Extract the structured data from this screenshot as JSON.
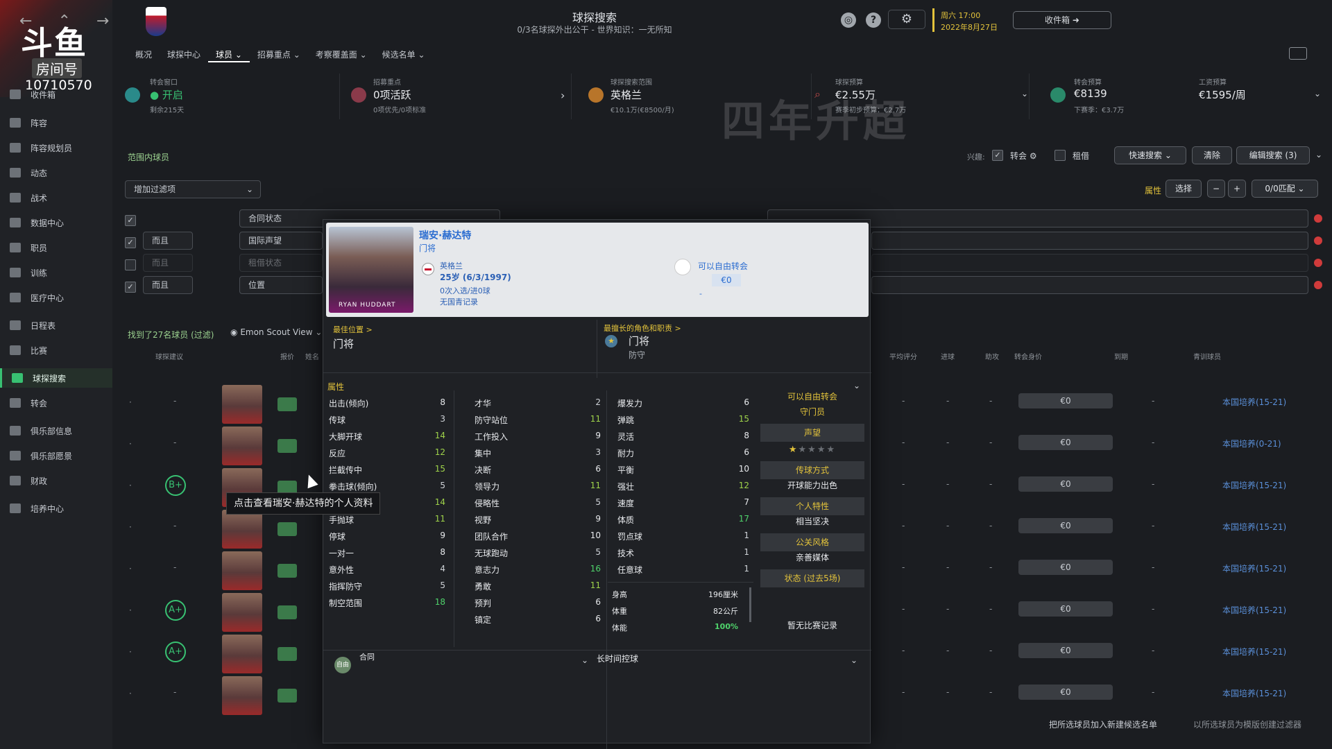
{
  "streamer": {
    "logo": "斗鱼",
    "room_label": "房间号",
    "room_id": "10710570"
  },
  "sidebar": {
    "items": [
      {
        "label": "收件箱",
        "icon": "home-icon"
      },
      {
        "label": "阵容",
        "icon": "shirt-icon"
      },
      {
        "label": "阵容规划员",
        "icon": "clipboard-icon"
      },
      {
        "label": "动态",
        "icon": "dynamics-icon"
      },
      {
        "label": "战术",
        "icon": "tactics-icon"
      },
      {
        "label": "数据中心",
        "icon": "data-icon"
      },
      {
        "label": "职员",
        "icon": "staff-icon"
      },
      {
        "label": "训练",
        "icon": "training-icon"
      },
      {
        "label": "医疗中心",
        "icon": "medical-icon"
      },
      {
        "label": "日程表",
        "icon": "calendar-icon"
      },
      {
        "label": "比赛",
        "icon": "trophy-icon"
      },
      {
        "label": "球探搜索",
        "icon": "search-icon"
      },
      {
        "label": "转会",
        "icon": "transfer-icon"
      },
      {
        "label": "俱乐部信息",
        "icon": "shield-icon"
      },
      {
        "label": "俱乐部愿景",
        "icon": "vision-icon"
      },
      {
        "label": "财政",
        "icon": "finance-icon"
      },
      {
        "label": "培养中心",
        "icon": "development-icon"
      }
    ]
  },
  "header": {
    "title": "球探搜索",
    "subtitle": "0/3名球探外出公干 - 世界知识：一无所知",
    "date_day": "周六 17:00",
    "date_date": "2022年8月27日",
    "inbox_label": "收件箱"
  },
  "tabs": [
    {
      "label": "概况"
    },
    {
      "label": "球探中心"
    },
    {
      "label": "球员 ⌄"
    },
    {
      "label": "招募重点 ⌄"
    },
    {
      "label": "考察覆盖面 ⌄"
    },
    {
      "label": "候选名单 ⌄"
    }
  ],
  "cards": {
    "window": {
      "label": "转会窗口",
      "value": "开启",
      "sub": "剩余215天"
    },
    "focus": {
      "label": "招募重点",
      "value": "0项活跃",
      "sub": "0项优先/0项标准"
    },
    "range": {
      "label": "球探搜索范围",
      "value": "英格兰",
      "sub": "€10.1万(€8500/月)"
    },
    "scout_budget": {
      "label": "球探预算",
      "value": "€2.55万",
      "sub": "赛季初步预算：€2.7万"
    },
    "transfer_budget": {
      "label": "转会预算",
      "value": "€8139",
      "sub": "下赛季：€3.7万"
    },
    "wage_budget": {
      "label": "工资预算",
      "value": "€1595/周"
    }
  },
  "watermark": "四年升超",
  "filters": {
    "section_label": "范围内球员",
    "add_filter": "增加过滤项",
    "interest_label": "兴趣:",
    "transfer_label": "转会",
    "loan_label": "租借",
    "quick_search": "快速搜索",
    "clear": "清除",
    "edit_search": "编辑搜索 (3)",
    "attr_label": "属性",
    "select": "选择",
    "match": "0/0匹配",
    "and": "而且",
    "rows": [
      "合同状态",
      "国际声望",
      "租借状态",
      "位置"
    ]
  },
  "results": {
    "found": "找到了27名球员 (过滤)",
    "view": "Emon Scout View",
    "cols": [
      "球探建议",
      "报价",
      "姓名",
      "平均评分",
      "进球",
      "助攻",
      "转会身价",
      "到期",
      "青训球员"
    ],
    "rows": [
      {
        "grade": "",
        "value": "€0",
        "link": "本国培养(15-21)"
      },
      {
        "grade": "",
        "value": "€0",
        "link": "本国培养(0-21)"
      },
      {
        "grade": "B+",
        "value": "€0",
        "link": "本国培养(15-21)"
      },
      {
        "grade": "",
        "value": "€0",
        "link": "本国培养(15-21)"
      },
      {
        "grade": "",
        "value": "€0",
        "link": "本国培养(15-21)"
      },
      {
        "grade": "A+",
        "value": "€0",
        "link": "本国培养(15-21)"
      },
      {
        "grade": "A+",
        "value": "€0",
        "link": "本国培养(15-21)"
      },
      {
        "grade": "",
        "value": "€0",
        "link": "本国培养(15-21)"
      }
    ],
    "dash": "-"
  },
  "popup": {
    "name": "瑞安·赫达特",
    "position": "门将",
    "photo_name": "RYAN HUDDART",
    "nation": "英格兰",
    "age": "25岁 (6/3/1997)",
    "caps": "0次入选/进0球",
    "youth": "无国青记录",
    "free_label": "可以自由转会",
    "fee": "€0",
    "fee_sub": "-",
    "best_pos_label": "最佳位置 >",
    "best_pos": "门将",
    "best_role_label": "最擅长的角色和职责 >",
    "best_role": "门将",
    "best_duty": "防守",
    "attr_title": "属性",
    "gk_attrs": [
      {
        "n": "出击(倾向)",
        "v": 8
      },
      {
        "n": "传球",
        "v": 3
      },
      {
        "n": "大脚开球",
        "v": 14
      },
      {
        "n": "反应",
        "v": 12
      },
      {
        "n": "拦截传中",
        "v": 15
      },
      {
        "n": "拳击球(倾向)",
        "v": 5
      },
      {
        "n": "",
        "v": 14
      },
      {
        "n": "手抛球",
        "v": 11
      },
      {
        "n": "停球",
        "v": 9
      },
      {
        "n": "一对一",
        "v": 8
      },
      {
        "n": "意外性",
        "v": 4
      },
      {
        "n": "指挥防守",
        "v": 5
      },
      {
        "n": "制空范围",
        "v": 18
      }
    ],
    "mental_attrs": [
      {
        "n": "才华",
        "v": 2
      },
      {
        "n": "防守站位",
        "v": 11
      },
      {
        "n": "工作投入",
        "v": 9
      },
      {
        "n": "集中",
        "v": 3
      },
      {
        "n": "决断",
        "v": 6
      },
      {
        "n": "领导力",
        "v": 11
      },
      {
        "n": "侵略性",
        "v": 5
      },
      {
        "n": "视野",
        "v": 9
      },
      {
        "n": "团队合作",
        "v": 10
      },
      {
        "n": "无球跑动",
        "v": 5
      },
      {
        "n": "意志力",
        "v": 16
      },
      {
        "n": "勇敢",
        "v": 11
      },
      {
        "n": "预判",
        "v": 6
      },
      {
        "n": "镇定",
        "v": 6
      }
    ],
    "physical_attrs": [
      {
        "n": "爆发力",
        "v": 6
      },
      {
        "n": "弹跳",
        "v": 15
      },
      {
        "n": "灵活",
        "v": 8
      },
      {
        "n": "耐力",
        "v": 6
      },
      {
        "n": "平衡",
        "v": 10
      },
      {
        "n": "强壮",
        "v": 12
      },
      {
        "n": "速度",
        "v": 7
      },
      {
        "n": "体质",
        "v": 17
      },
      {
        "n": "罚点球",
        "v": 1
      },
      {
        "n": "技术",
        "v": 1
      },
      {
        "n": "任意球",
        "v": 1
      }
    ],
    "height_label": "身高",
    "height": "196厘米",
    "weight_label": "体重",
    "weight": "82公斤",
    "stamina_label": "体能",
    "stamina": "100%",
    "side": {
      "free": "可以自由转会",
      "role": "守门员",
      "rep_label": "声望",
      "rep_stars": 0.5,
      "throw_label": "传球方式",
      "throw": "开球能力出色",
      "trait_label": "个人特性",
      "trait": "相当坚决",
      "media_label": "公关风格",
      "media": "亲善媒体",
      "form_label": "状态 (过去5场)",
      "form": "暂无比赛记录"
    },
    "contract_label": "合同",
    "contract_badge": "自由",
    "long_label": "长时间控球"
  },
  "tooltip": "点击查看瑞安·赫达特的个人资料",
  "bottom": {
    "add_shortlist": "把所选球员加入新建候选名单",
    "create_filter": "以所选球员为模版创建过滤器"
  },
  "colors": {
    "accent_green": "#38c172",
    "gold": "#e3c33b",
    "link_blue": "#2a6cd0"
  }
}
